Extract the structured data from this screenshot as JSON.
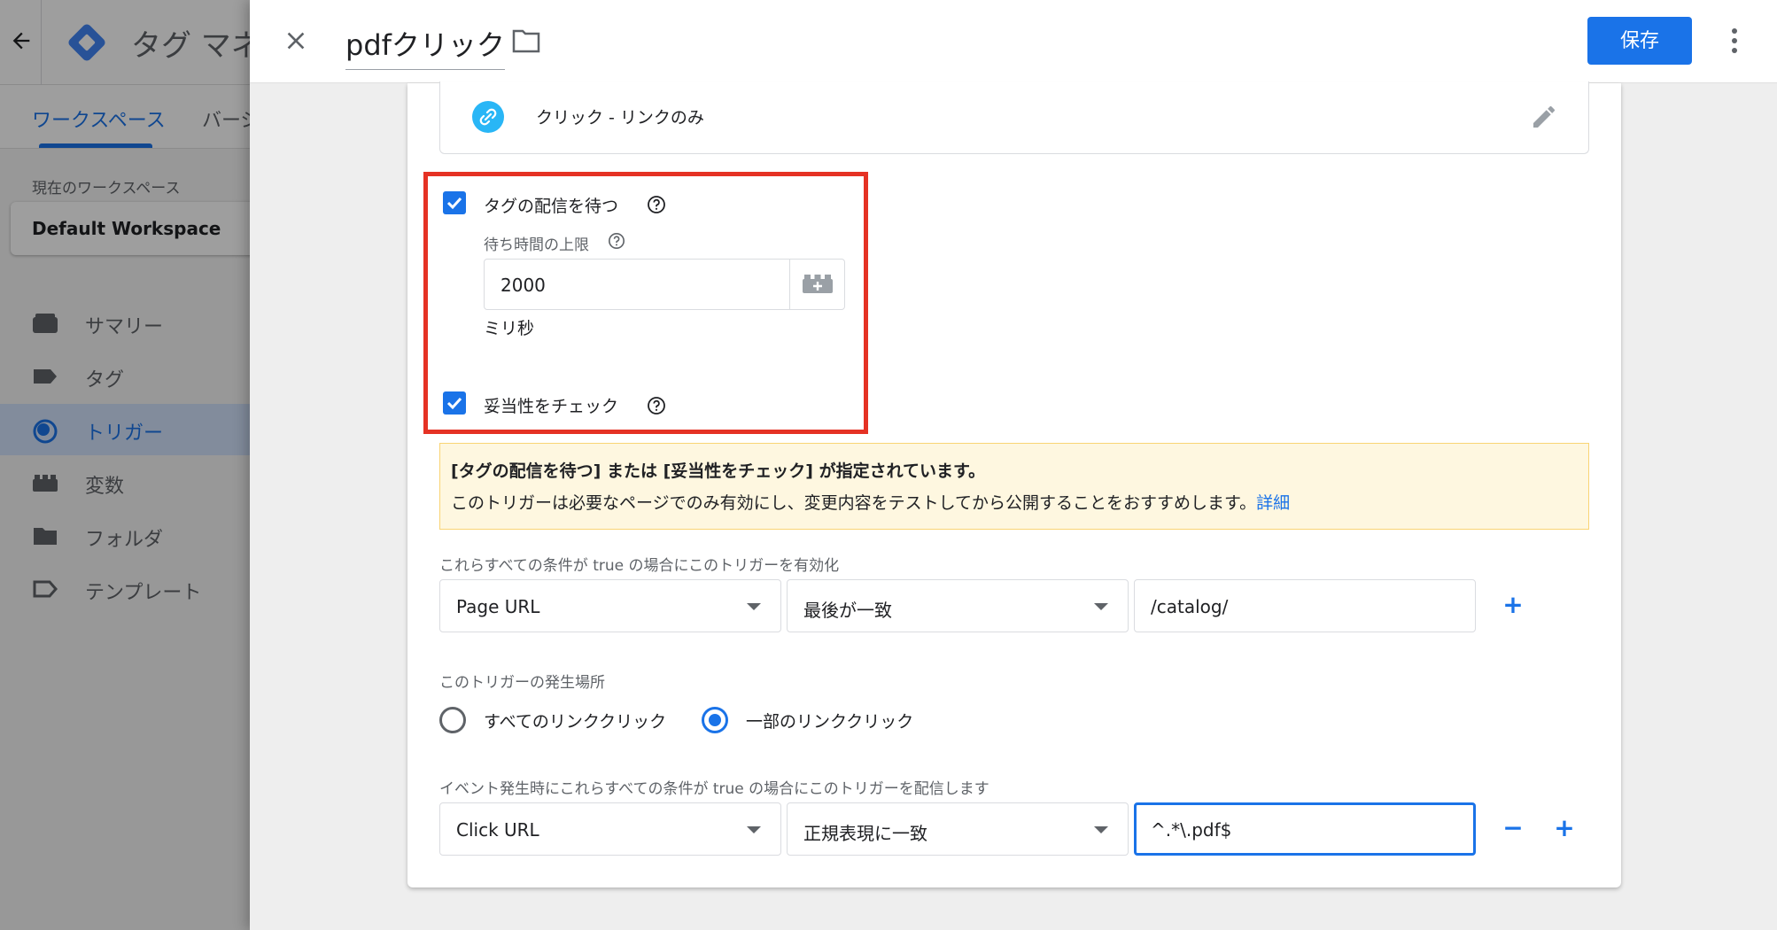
{
  "background_app": {
    "app_title": "タグ マネ",
    "tabs": [
      "ワークスペース",
      "バージ"
    ],
    "workspace_label": "現在のワークスペース",
    "workspace_name": "Default Workspace",
    "nav_items": [
      {
        "label": "サマリー",
        "icon": "overview-icon"
      },
      {
        "label": "タグ",
        "icon": "tag-icon"
      },
      {
        "label": "トリガー",
        "icon": "trigger-icon",
        "active": true
      },
      {
        "label": "変数",
        "icon": "variables-icon"
      },
      {
        "label": "フォルダ",
        "icon": "folder-icon"
      },
      {
        "label": "テンプレート",
        "icon": "template-icon"
      }
    ]
  },
  "header": {
    "title": "pdfクリック",
    "save_label": "保存"
  },
  "trigger_type": {
    "label": "クリック - リンクのみ",
    "icon": "link-icon"
  },
  "options": {
    "wait_for_tags": {
      "label": "タグの配信を待つ",
      "checked": true
    },
    "max_wait_label": "待ち時間の上限",
    "max_wait_value": "2000",
    "unit": "ミリ秒",
    "check_validation": {
      "label": "妥当性をチェック",
      "checked": true
    }
  },
  "warning": {
    "title": "[タグの配信を待つ] または [妥当性をチェック] が指定されています。",
    "body": "このトリガーは必要なページでのみ有効にし、変更内容をテストしてから公開することをおすすめします。",
    "link": "詳細"
  },
  "enable_conditions": {
    "label": "これらすべての条件が true の場合にこのトリガーを有効化",
    "variable": "Page URL",
    "operator": "最後が一致",
    "value": "/catalog/",
    "add": "+"
  },
  "fire_on": {
    "label": "このトリガーの発生場所",
    "options": [
      "すべてのリンククリック",
      "一部のリンククリック"
    ],
    "selected": "一部のリンククリック"
  },
  "fire_conditions": {
    "label": "イベント発生時にこれらすべての条件が true の場合にこのトリガーを配信します",
    "variable": "Click URL",
    "operator": "正規表現に一致",
    "value": "^.*\\.pdf$",
    "remove": "−",
    "add": "+"
  },
  "colors": {
    "primary": "#1a73e8",
    "highlight_border": "#e53224",
    "warning_bg": "#fef7e0",
    "link_icon_bg": "#29b6f6"
  }
}
